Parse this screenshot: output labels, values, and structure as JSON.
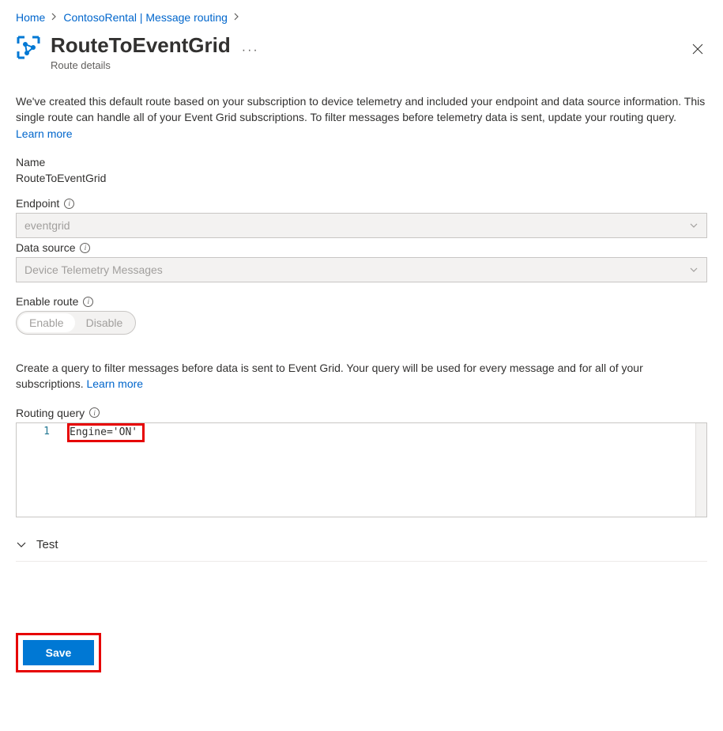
{
  "breadcrumb": {
    "home": "Home",
    "parent": "ContosoRental | Message routing"
  },
  "header": {
    "title": "RouteToEventGrid",
    "subtitle": "Route details"
  },
  "intro": {
    "text": "We've created this default route based on your subscription to device telemetry and included your endpoint and data source information. This single route can handle all of your Event Grid subscriptions. To filter messages before telemetry data is sent, update your routing query. ",
    "learn_more": "Learn more"
  },
  "fields": {
    "name_label": "Name",
    "name_value": "RouteToEventGrid",
    "endpoint_label": "Endpoint",
    "endpoint_value": "eventgrid",
    "datasource_label": "Data source",
    "datasource_value": "Device Telemetry Messages",
    "enable_label": "Enable route",
    "enable_on": "Enable",
    "enable_off": "Disable"
  },
  "query_section": {
    "text": "Create a query to filter messages before data is sent to Event Grid. Your query will be used for every message and for all of your subscriptions. ",
    "learn_more": "Learn more",
    "label": "Routing query",
    "line_number": "1",
    "code": "Engine='ON'"
  },
  "expander": {
    "test": "Test"
  },
  "footer": {
    "save": "Save"
  }
}
